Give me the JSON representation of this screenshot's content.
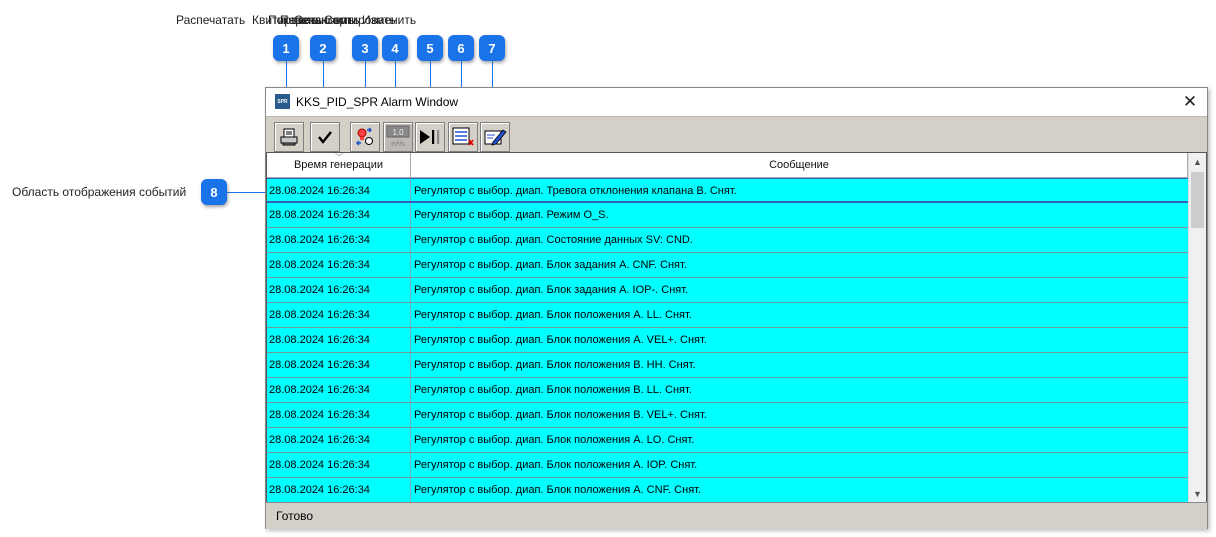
{
  "callout_labels": [
    "Распечатать",
    "Квитировать",
    "Показать",
    "Переключить",
    "Остановить",
    "Сортировать",
    "Изменить"
  ],
  "callouts": [
    "1",
    "2",
    "3",
    "4",
    "5",
    "6",
    "7"
  ],
  "events_area": {
    "badge": "8",
    "label": "Область отображения событий"
  },
  "window": {
    "icon": "SPR",
    "title": "KKS_PID_SPR Alarm Window",
    "close_icon": "✕"
  },
  "toolbar": {
    "buttons": [
      {
        "icon": "printer-icon"
      },
      {
        "icon": "checkmark-icon"
      },
      {
        "icon": "alarm-filter-icon"
      },
      {
        "icon": "units-icon",
        "value": "1.0",
        "unit": "m³/s"
      },
      {
        "icon": "play-pause-icon",
        "glyph": "▶||"
      },
      {
        "icon": "list-remove-icon"
      },
      {
        "icon": "edit-note-icon"
      }
    ]
  },
  "table": {
    "columns": [
      "Время генерации",
      "Сообщение"
    ],
    "rows": [
      {
        "time": "28.08.2024 16:26:34",
        "message": "Регулятор с выбор. диап. Тревога отклонения клапана B. Снят."
      },
      {
        "time": "28.08.2024 16:26:34",
        "message": "Регулятор с выбор. диап. Режим O_S."
      },
      {
        "time": "28.08.2024 16:26:34",
        "message": "Регулятор с выбор. диап. Состояние данных SV: CND."
      },
      {
        "time": "28.08.2024 16:26:34",
        "message": "Регулятор с выбор. диап. Блок задания A. CNF. Снят."
      },
      {
        "time": "28.08.2024 16:26:34",
        "message": "Регулятор с выбор. диап. Блок задания A. IOP-. Снят."
      },
      {
        "time": "28.08.2024 16:26:34",
        "message": "Регулятор с выбор. диап. Блок положения A. LL. Снят."
      },
      {
        "time": "28.08.2024 16:26:34",
        "message": "Регулятор с выбор. диап. Блок положения A. VEL+. Снят."
      },
      {
        "time": "28.08.2024 16:26:34",
        "message": "Регулятор с выбор. диап. Блок положения B. HH. Снят."
      },
      {
        "time": "28.08.2024 16:26:34",
        "message": "Регулятор с выбор. диап. Блок положения B. LL. Снят."
      },
      {
        "time": "28.08.2024 16:26:34",
        "message": "Регулятор с выбор. диап. Блок положения B. VEL+. Снят."
      },
      {
        "time": "28.08.2024 16:26:34",
        "message": "Регулятор с выбор. диап. Блок положения A. LO. Снят."
      },
      {
        "time": "28.08.2024 16:26:34",
        "message": "Регулятор с выбор. диап. Блок положения A. IOP. Снят."
      },
      {
        "time": "28.08.2024 16:26:34",
        "message": "Регулятор с выбор. диап. Блок положения A. CNF. Снят."
      }
    ]
  },
  "scrollbar": {
    "up": "▲",
    "down": "▼"
  },
  "status": {
    "text": "Готово"
  },
  "colors": {
    "row_bg": "#00ffff",
    "callout": "#1a73e8",
    "selection": "#3060c0"
  }
}
